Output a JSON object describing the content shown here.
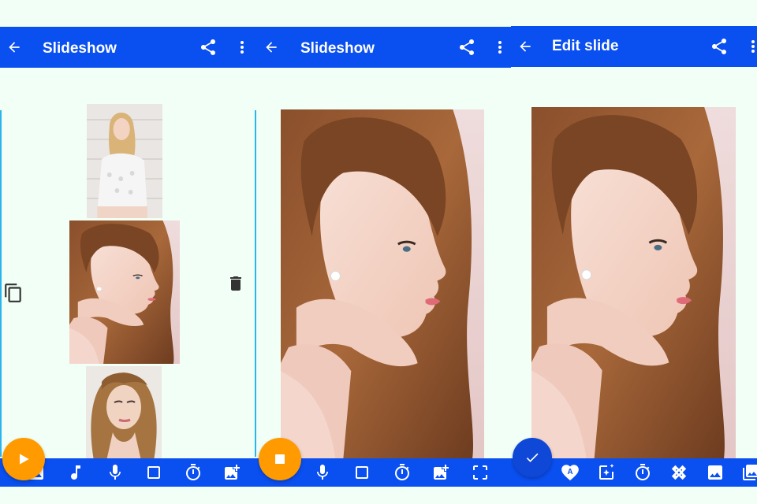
{
  "screens": [
    {
      "title": "Slideshow",
      "fab": "play-icon"
    },
    {
      "title": "Slideshow",
      "fab": "stop-icon"
    },
    {
      "title": "Edit slide",
      "fab": "check-icon"
    }
  ],
  "colors": {
    "app_bar": "#0a4ff0",
    "background": "#f2fff6",
    "fab_orange": "#ff9a00",
    "fab_blue": "#0f47d6",
    "accent_line": "#28b4ef"
  },
  "screen1_side_icons": [
    "copy-icon",
    "delete-icon"
  ],
  "screen1_toolbar": [
    "image-icon",
    "music-note-icon",
    "microphone-icon",
    "crop-square-icon",
    "timer-icon",
    "add-photo-icon"
  ],
  "screen2_toolbar": [
    "microphone-icon",
    "crop-square-icon",
    "timer-icon",
    "add-photo-icon",
    "crop-free-icon"
  ],
  "screen3_toolbar": [
    "text-heart-icon",
    "sparkle-image-icon",
    "timer-icon",
    "transition-icon",
    "image-icon",
    "photo-library-icon"
  ]
}
